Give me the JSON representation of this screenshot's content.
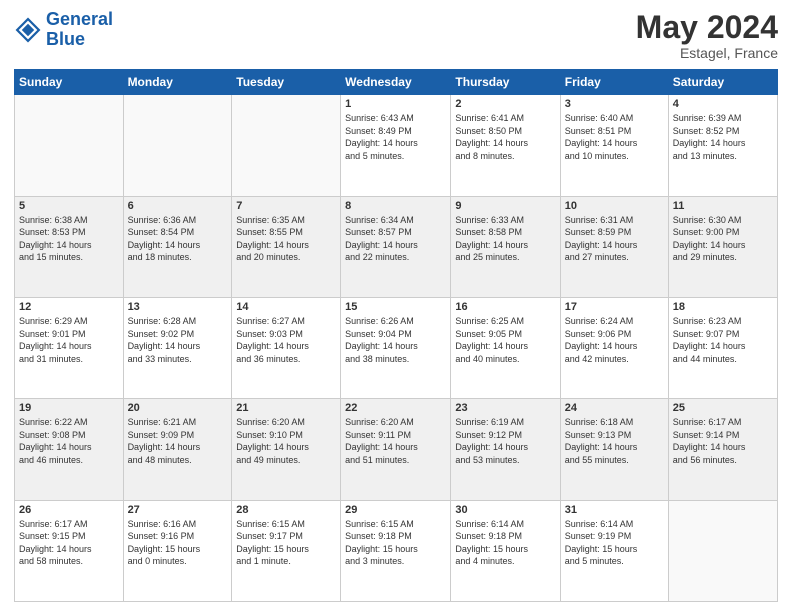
{
  "header": {
    "logo_line1": "General",
    "logo_line2": "Blue",
    "month": "May 2024",
    "location": "Estagel, France"
  },
  "weekdays": [
    "Sunday",
    "Monday",
    "Tuesday",
    "Wednesday",
    "Thursday",
    "Friday",
    "Saturday"
  ],
  "weeks": [
    [
      {
        "day": "",
        "info": ""
      },
      {
        "day": "",
        "info": ""
      },
      {
        "day": "",
        "info": ""
      },
      {
        "day": "1",
        "info": "Sunrise: 6:43 AM\nSunset: 8:49 PM\nDaylight: 14 hours\nand 5 minutes."
      },
      {
        "day": "2",
        "info": "Sunrise: 6:41 AM\nSunset: 8:50 PM\nDaylight: 14 hours\nand 8 minutes."
      },
      {
        "day": "3",
        "info": "Sunrise: 6:40 AM\nSunset: 8:51 PM\nDaylight: 14 hours\nand 10 minutes."
      },
      {
        "day": "4",
        "info": "Sunrise: 6:39 AM\nSunset: 8:52 PM\nDaylight: 14 hours\nand 13 minutes."
      }
    ],
    [
      {
        "day": "5",
        "info": "Sunrise: 6:38 AM\nSunset: 8:53 PM\nDaylight: 14 hours\nand 15 minutes."
      },
      {
        "day": "6",
        "info": "Sunrise: 6:36 AM\nSunset: 8:54 PM\nDaylight: 14 hours\nand 18 minutes."
      },
      {
        "day": "7",
        "info": "Sunrise: 6:35 AM\nSunset: 8:55 PM\nDaylight: 14 hours\nand 20 minutes."
      },
      {
        "day": "8",
        "info": "Sunrise: 6:34 AM\nSunset: 8:57 PM\nDaylight: 14 hours\nand 22 minutes."
      },
      {
        "day": "9",
        "info": "Sunrise: 6:33 AM\nSunset: 8:58 PM\nDaylight: 14 hours\nand 25 minutes."
      },
      {
        "day": "10",
        "info": "Sunrise: 6:31 AM\nSunset: 8:59 PM\nDaylight: 14 hours\nand 27 minutes."
      },
      {
        "day": "11",
        "info": "Sunrise: 6:30 AM\nSunset: 9:00 PM\nDaylight: 14 hours\nand 29 minutes."
      }
    ],
    [
      {
        "day": "12",
        "info": "Sunrise: 6:29 AM\nSunset: 9:01 PM\nDaylight: 14 hours\nand 31 minutes."
      },
      {
        "day": "13",
        "info": "Sunrise: 6:28 AM\nSunset: 9:02 PM\nDaylight: 14 hours\nand 33 minutes."
      },
      {
        "day": "14",
        "info": "Sunrise: 6:27 AM\nSunset: 9:03 PM\nDaylight: 14 hours\nand 36 minutes."
      },
      {
        "day": "15",
        "info": "Sunrise: 6:26 AM\nSunset: 9:04 PM\nDaylight: 14 hours\nand 38 minutes."
      },
      {
        "day": "16",
        "info": "Sunrise: 6:25 AM\nSunset: 9:05 PM\nDaylight: 14 hours\nand 40 minutes."
      },
      {
        "day": "17",
        "info": "Sunrise: 6:24 AM\nSunset: 9:06 PM\nDaylight: 14 hours\nand 42 minutes."
      },
      {
        "day": "18",
        "info": "Sunrise: 6:23 AM\nSunset: 9:07 PM\nDaylight: 14 hours\nand 44 minutes."
      }
    ],
    [
      {
        "day": "19",
        "info": "Sunrise: 6:22 AM\nSunset: 9:08 PM\nDaylight: 14 hours\nand 46 minutes."
      },
      {
        "day": "20",
        "info": "Sunrise: 6:21 AM\nSunset: 9:09 PM\nDaylight: 14 hours\nand 48 minutes."
      },
      {
        "day": "21",
        "info": "Sunrise: 6:20 AM\nSunset: 9:10 PM\nDaylight: 14 hours\nand 49 minutes."
      },
      {
        "day": "22",
        "info": "Sunrise: 6:20 AM\nSunset: 9:11 PM\nDaylight: 14 hours\nand 51 minutes."
      },
      {
        "day": "23",
        "info": "Sunrise: 6:19 AM\nSunset: 9:12 PM\nDaylight: 14 hours\nand 53 minutes."
      },
      {
        "day": "24",
        "info": "Sunrise: 6:18 AM\nSunset: 9:13 PM\nDaylight: 14 hours\nand 55 minutes."
      },
      {
        "day": "25",
        "info": "Sunrise: 6:17 AM\nSunset: 9:14 PM\nDaylight: 14 hours\nand 56 minutes."
      }
    ],
    [
      {
        "day": "26",
        "info": "Sunrise: 6:17 AM\nSunset: 9:15 PM\nDaylight: 14 hours\nand 58 minutes."
      },
      {
        "day": "27",
        "info": "Sunrise: 6:16 AM\nSunset: 9:16 PM\nDaylight: 15 hours\nand 0 minutes."
      },
      {
        "day": "28",
        "info": "Sunrise: 6:15 AM\nSunset: 9:17 PM\nDaylight: 15 hours\nand 1 minute."
      },
      {
        "day": "29",
        "info": "Sunrise: 6:15 AM\nSunset: 9:18 PM\nDaylight: 15 hours\nand 3 minutes."
      },
      {
        "day": "30",
        "info": "Sunrise: 6:14 AM\nSunset: 9:18 PM\nDaylight: 15 hours\nand 4 minutes."
      },
      {
        "day": "31",
        "info": "Sunrise: 6:14 AM\nSunset: 9:19 PM\nDaylight: 15 hours\nand 5 minutes."
      },
      {
        "day": "",
        "info": ""
      }
    ]
  ]
}
